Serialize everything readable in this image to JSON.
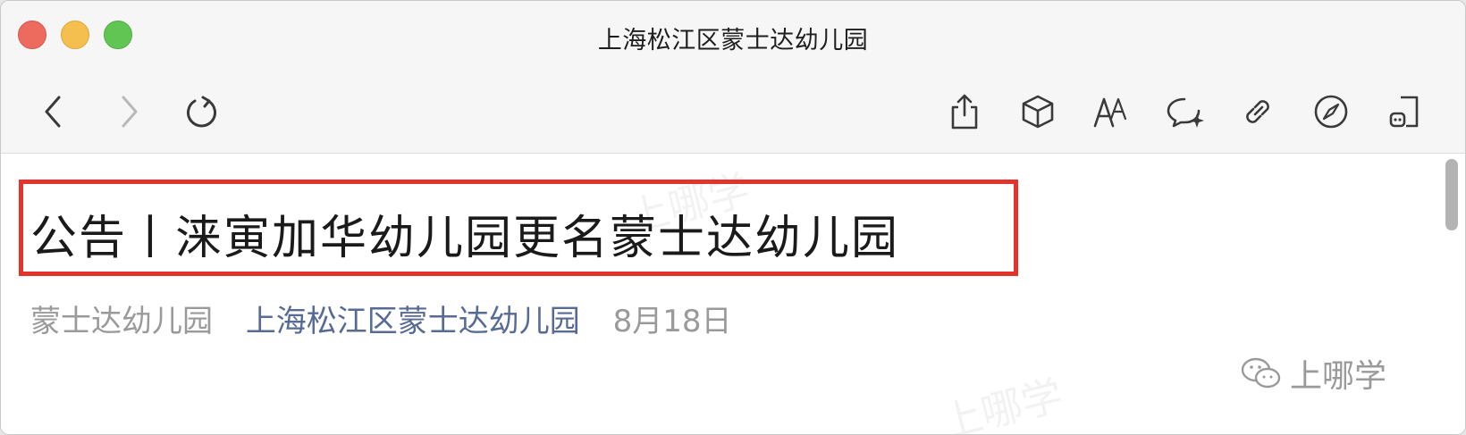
{
  "window": {
    "title": "上海松江区蒙士达幼儿园"
  },
  "toolbar": {
    "left_icons": [
      "back-icon",
      "forward-icon",
      "reload-icon"
    ],
    "right_icons": [
      "share-icon",
      "cube-icon",
      "text-size-icon",
      "comment-icon",
      "link-icon",
      "compass-icon",
      "open-in-icon"
    ]
  },
  "article": {
    "title": "公告丨涞寅加华幼儿园更名蒙士达幼儿园",
    "author": "蒙士达幼儿园",
    "account": "上海松江区蒙士达幼儿园",
    "date": "8月18日"
  },
  "watermark": {
    "label": "上哪学"
  },
  "colors": {
    "highlight_border": "#e3342b",
    "account_link": "#576b95",
    "meta_gray": "#9a9a9a"
  }
}
